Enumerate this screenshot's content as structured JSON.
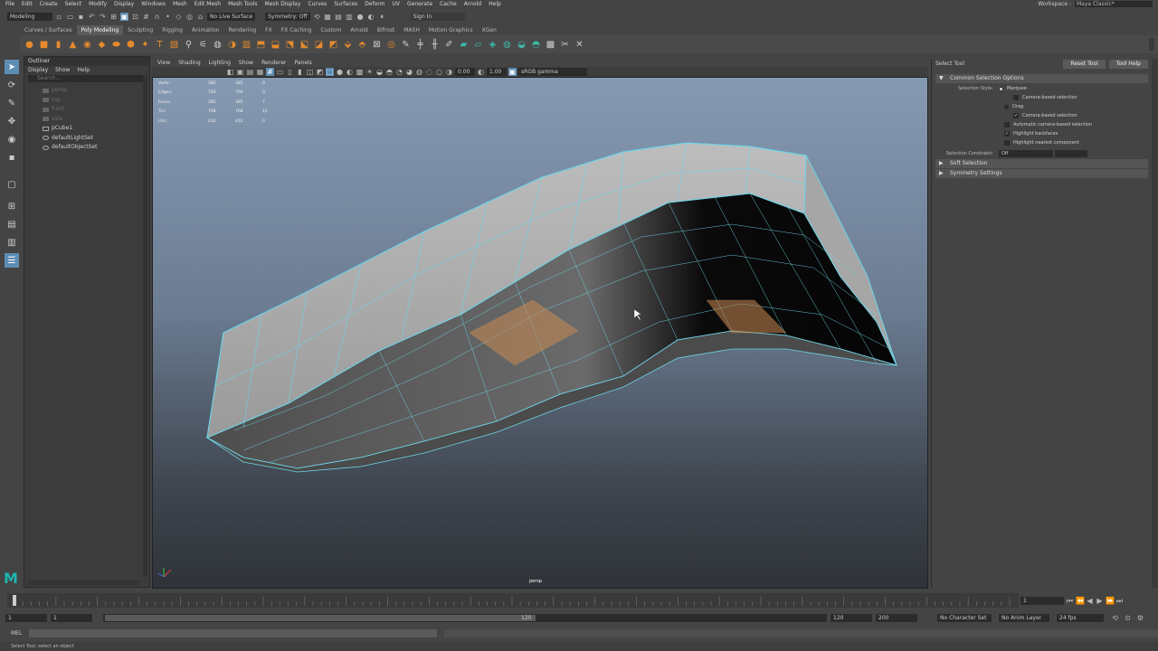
{
  "menubar": {
    "items": [
      "File",
      "Edit",
      "Create",
      "Select",
      "Modify",
      "Display",
      "Windows",
      "Mesh",
      "Edit Mesh",
      "Mesh Tools",
      "Mesh Display",
      "Curves",
      "Surfaces",
      "Deform",
      "UV",
      "Generate",
      "Cache",
      "Arnold",
      "Help"
    ],
    "workspace_label": "Workspace :",
    "workspace_value": "Maya Classic*"
  },
  "statusline": {
    "mode": "Modeling",
    "live_surface": "No Live Surface",
    "symmetry": "Symmetry: Off",
    "sign_in": "Sign In"
  },
  "shelf": {
    "tabs": [
      "Curves / Surfaces",
      "Poly Modeling",
      "Sculpting",
      "Rigging",
      "Animation",
      "Rendering",
      "FX",
      "FX Caching",
      "Custom",
      "Arnold",
      "Bifrost",
      "MASH",
      "Motion Graphics",
      "XGen"
    ],
    "active_tab": "Poly Modeling"
  },
  "outliner": {
    "title": "Outliner",
    "menu": [
      "Display",
      "Show",
      "Help"
    ],
    "search_placeholder": "Search...",
    "items": [
      {
        "label": "persp",
        "dim": true
      },
      {
        "label": "top",
        "dim": true
      },
      {
        "label": "front",
        "dim": true
      },
      {
        "label": "side",
        "dim": true
      },
      {
        "label": "pCube1",
        "dim": false
      },
      {
        "label": "defaultLightSet",
        "dim": false
      },
      {
        "label": "defaultObjectSet",
        "dim": false
      }
    ]
  },
  "viewport": {
    "menu": [
      "View",
      "Shading",
      "Lighting",
      "Show",
      "Renderer",
      "Panels"
    ],
    "exposure": "0.00",
    "gamma": "1.00",
    "color_space": "sRGB gamma",
    "camera": "persp",
    "hud": [
      {
        "label": "Verts:",
        "a": "385",
        "b": "385",
        "c": "0"
      },
      {
        "label": "Edges:",
        "a": "760",
        "b": "760",
        "c": "0"
      },
      {
        "label": "Faces:",
        "a": "385",
        "b": "385",
        "c": "7"
      },
      {
        "label": "Tris:",
        "a": "768",
        "b": "768",
        "c": "12"
      },
      {
        "label": "UVs:",
        "a": "432",
        "b": "432",
        "c": "0"
      }
    ]
  },
  "attribute_editor": {
    "title": "Select Tool",
    "reset_label": "Reset Tool",
    "help_label": "Tool Help",
    "section_common": "Common Selection Options",
    "selection_style_label": "Selection Style:",
    "marquee": "Marquee",
    "camera_based_1": "Camera-based selection",
    "drag": "Drag",
    "camera_based_2": "Camera-based selection",
    "auto_camera": "Automatic camera-based selection",
    "highlight_backfaces": "Highlight backfaces",
    "highlight_nearest": "Highlight nearest component",
    "constraint_label": "Selection Constraint:",
    "constraint_value": "Off",
    "section_soft": "Soft Selection",
    "section_symmetry": "Symmetry Settings"
  },
  "time": {
    "current_frame": "1",
    "range_start": "1",
    "range_start_inner": "1",
    "slider_end": "120",
    "range_end": "120",
    "anim_end": "200",
    "character_set": "No Character Set",
    "anim_layer": "No Anim Layer",
    "fps": "24 fps"
  },
  "mel_label": "MEL",
  "help_line": "Select Tool: select an object",
  "colors": {
    "accent": "#5e8db4",
    "wire": "#6fd3e6",
    "shelf_orange": "#e68a2e",
    "shelf_teal": "#3fb8a8"
  }
}
